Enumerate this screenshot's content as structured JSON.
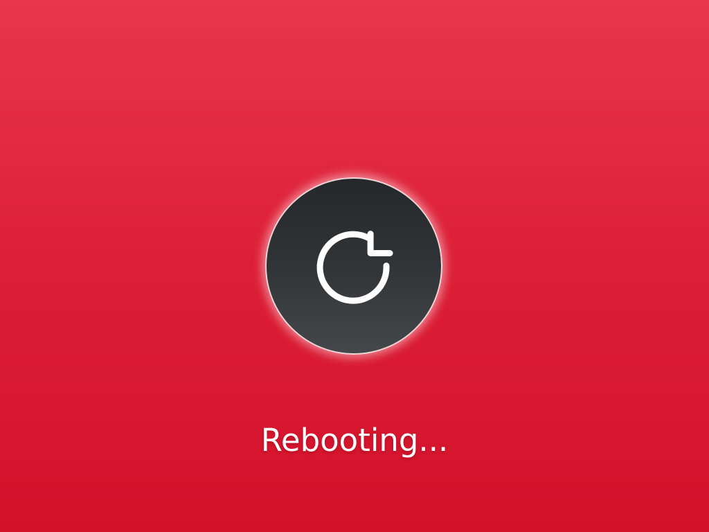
{
  "screen": {
    "status_text": "Rebooting...",
    "icon": "reboot-icon",
    "colors": {
      "background_top": "#e8364c",
      "background_bottom": "#d3122a",
      "circle_top": "#25282b",
      "circle_bottom": "#45484a",
      "icon": "#ffffff",
      "text": "#ffffff"
    }
  }
}
